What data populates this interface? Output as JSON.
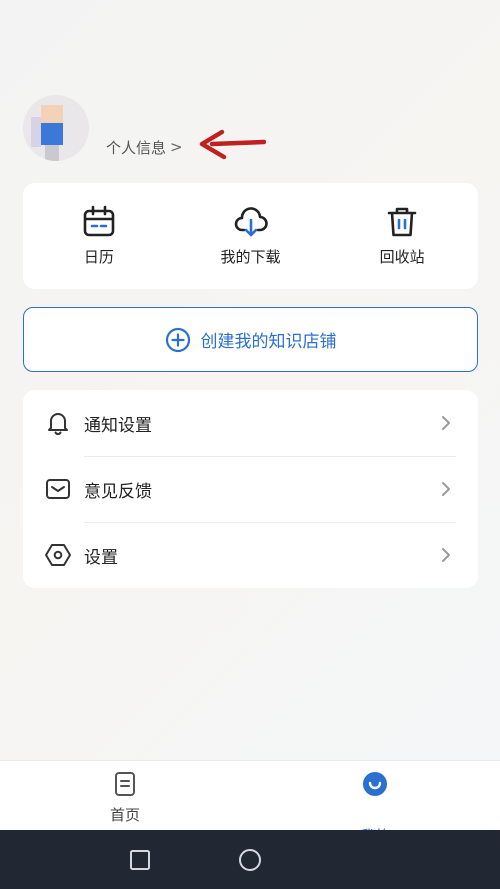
{
  "profile": {
    "info_label": "个人信息",
    "chevron": ">"
  },
  "quick_actions": [
    {
      "label": "日历",
      "icon": "calendar-icon"
    },
    {
      "label": "我的下载",
      "icon": "cloud-download-icon"
    },
    {
      "label": "回收站",
      "icon": "trash-icon"
    }
  ],
  "create_store": {
    "label": "创建我的知识店铺",
    "icon": "plus-circle-icon"
  },
  "settings_list": [
    {
      "label": "通知设置",
      "icon": "bell-icon"
    },
    {
      "label": "意见反馈",
      "icon": "envelope-icon"
    },
    {
      "label": "设置",
      "icon": "hexagon-settings-icon"
    }
  ],
  "bottom_nav": {
    "home_label": "首页",
    "me_label": "我的"
  },
  "colors": {
    "accent": "#2b6fd1",
    "annotation_arrow": "#c0201e",
    "system_bar": "#222734"
  }
}
